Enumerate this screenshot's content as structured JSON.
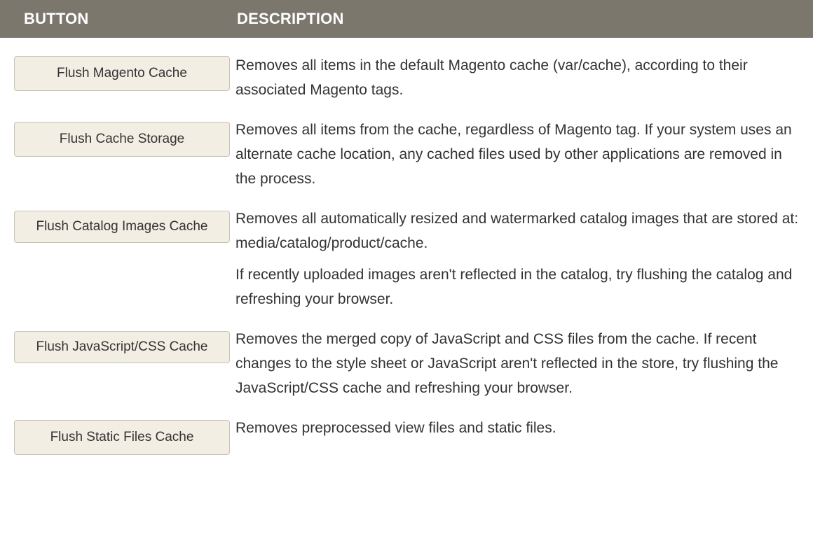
{
  "table": {
    "headers": {
      "button": "BUTTON",
      "description": "DESCRIPTION"
    },
    "rows": [
      {
        "button": "Flush Magento Cache",
        "paragraphs": [
          "Removes all items in the default Magento cache (var/cache), according to their associated Magento tags."
        ]
      },
      {
        "button": "Flush Cache Storage",
        "paragraphs": [
          "Removes all items from the cache, regardless of Magento tag. If your system uses an alternate cache location, any cached files used by other applications are removed in the process."
        ]
      },
      {
        "button": "Flush Catalog Images Cache",
        "paragraphs": [
          "Removes all automatically resized and watermarked catalog images that are stored at: media/catalog/product/cache.",
          "If recently uploaded images aren't reflected in the catalog, try flushing the catalog and refreshing your browser."
        ]
      },
      {
        "button": "Flush JavaScript/CSS Cache",
        "paragraphs": [
          "Removes the merged copy of JavaScript and CSS files from the cache. If recent changes to the style sheet or JavaScript aren't reflected in the store, try flushing the JavaScript/CSS cache and refreshing your browser."
        ]
      },
      {
        "button": "Flush Static Files Cache",
        "paragraphs": [
          "Removes preprocessed view files and static files."
        ]
      }
    ]
  },
  "colors": {
    "header_background": "#7b776d",
    "header_text": "#ffffff",
    "button_background": "#f3eee3",
    "button_border": "#c9c2b2",
    "body_text": "#333333"
  }
}
